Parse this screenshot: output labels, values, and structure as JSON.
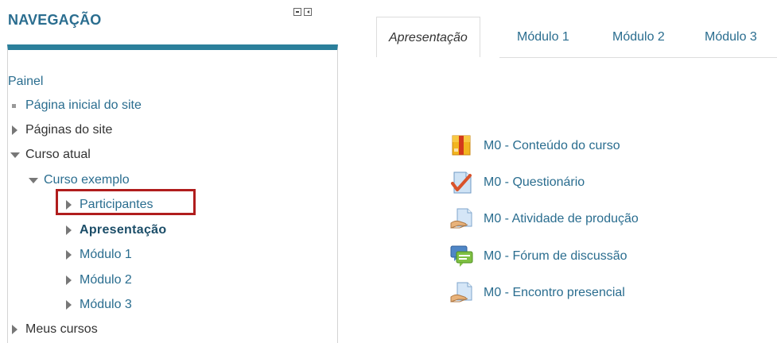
{
  "nav": {
    "title": "NAVEGAÇÃO",
    "root": "Painel",
    "items": [
      {
        "label": "Página inicial do site"
      },
      {
        "label": "Páginas do site"
      },
      {
        "label": "Curso atual"
      },
      {
        "label": "Curso exemplo"
      },
      {
        "label": "Participantes"
      },
      {
        "label": "Apresentação"
      },
      {
        "label": "Módulo 1"
      },
      {
        "label": "Módulo 2"
      },
      {
        "label": "Módulo 3"
      },
      {
        "label": "Meus cursos"
      }
    ]
  },
  "tabs": [
    {
      "label": "Apresentação",
      "active": true
    },
    {
      "label": "Módulo 1"
    },
    {
      "label": "Módulo 2"
    },
    {
      "label": "Módulo 3"
    }
  ],
  "activities": [
    {
      "label": "M0 - Conteúdo do curso",
      "icon": "package-icon"
    },
    {
      "label": "M0 - Questionário",
      "icon": "quiz-icon"
    },
    {
      "label": "M0 - Atividade de produção",
      "icon": "assignment-icon"
    },
    {
      "label": "M0 - Fórum de discussão",
      "icon": "forum-icon"
    },
    {
      "label": "M0 - Encontro presencial",
      "icon": "assignment-icon"
    }
  ],
  "colors": {
    "link": "#2a6d8f",
    "block_accent": "#2b7f9b",
    "highlight": "#b01d1d"
  }
}
